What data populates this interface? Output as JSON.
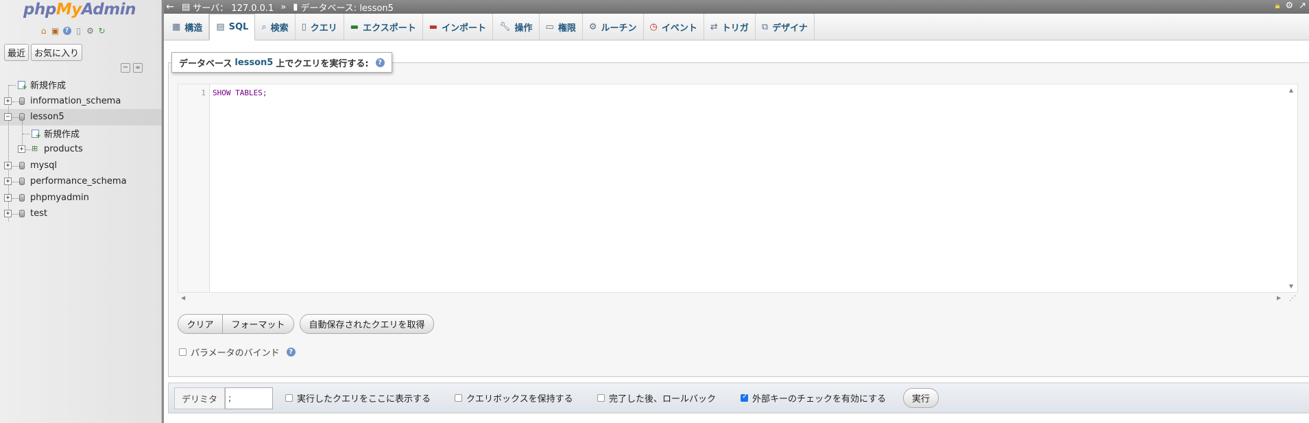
{
  "logo": {
    "php": "php",
    "my": "My",
    "admin": "Admin"
  },
  "nav": {
    "tabs": {
      "recent": "最近",
      "favorites": "お気に入り"
    },
    "tree": {
      "new": "新規作成",
      "db1": "information_schema",
      "db2": "lesson5",
      "db2_new": "新規作成",
      "db2_table": "products",
      "db3": "mysql",
      "db4": "performance_schema",
      "db5": "phpmyadmin",
      "db6": "test"
    }
  },
  "breadcrumb": {
    "server": "サーバ： 127.0.0.1",
    "separator": "»",
    "database": "データベース: lesson5"
  },
  "tabs": {
    "structure": "構造",
    "sql": "SQL",
    "search": "検索",
    "query": "クエリ",
    "export": "エクスポート",
    "import": "インポート",
    "operations": "操作",
    "privileges": "権限",
    "routines": "ルーチン",
    "events": "イベント",
    "triggers": "トリガ",
    "designer": "デザイナ"
  },
  "query": {
    "legend_prefix": "データベース",
    "legend_db": "lesson5",
    "legend_suffix": "上でクエリを実行する:",
    "line_number": "1",
    "code_kw1": "SHOW",
    "code_kw2": "TABLES",
    "code_end": ";"
  },
  "buttons": {
    "clear": "クリア",
    "format": "フォーマット",
    "autosaved": "自動保存されたクエリを取得",
    "go": "実行"
  },
  "bind_params": {
    "label": "パラメータのバインド",
    "checked": false
  },
  "options": {
    "delimiter_label": "デリミタ",
    "delimiter_value": ";",
    "show_query": {
      "label": "実行したクエリをここに表示する",
      "checked": false
    },
    "retain_box": {
      "label": "クエリボックスを保持する",
      "checked": false
    },
    "rollback": {
      "label": "完了した後、ロールバック",
      "checked": false
    },
    "fk_checks": {
      "label": "外部キーのチェックを有効にする",
      "checked": true
    }
  },
  "colors": {
    "link": "#235a81",
    "keyword": "#770088",
    "logo_orange": "#f89c0e",
    "logo_blue": "#6c78af"
  }
}
